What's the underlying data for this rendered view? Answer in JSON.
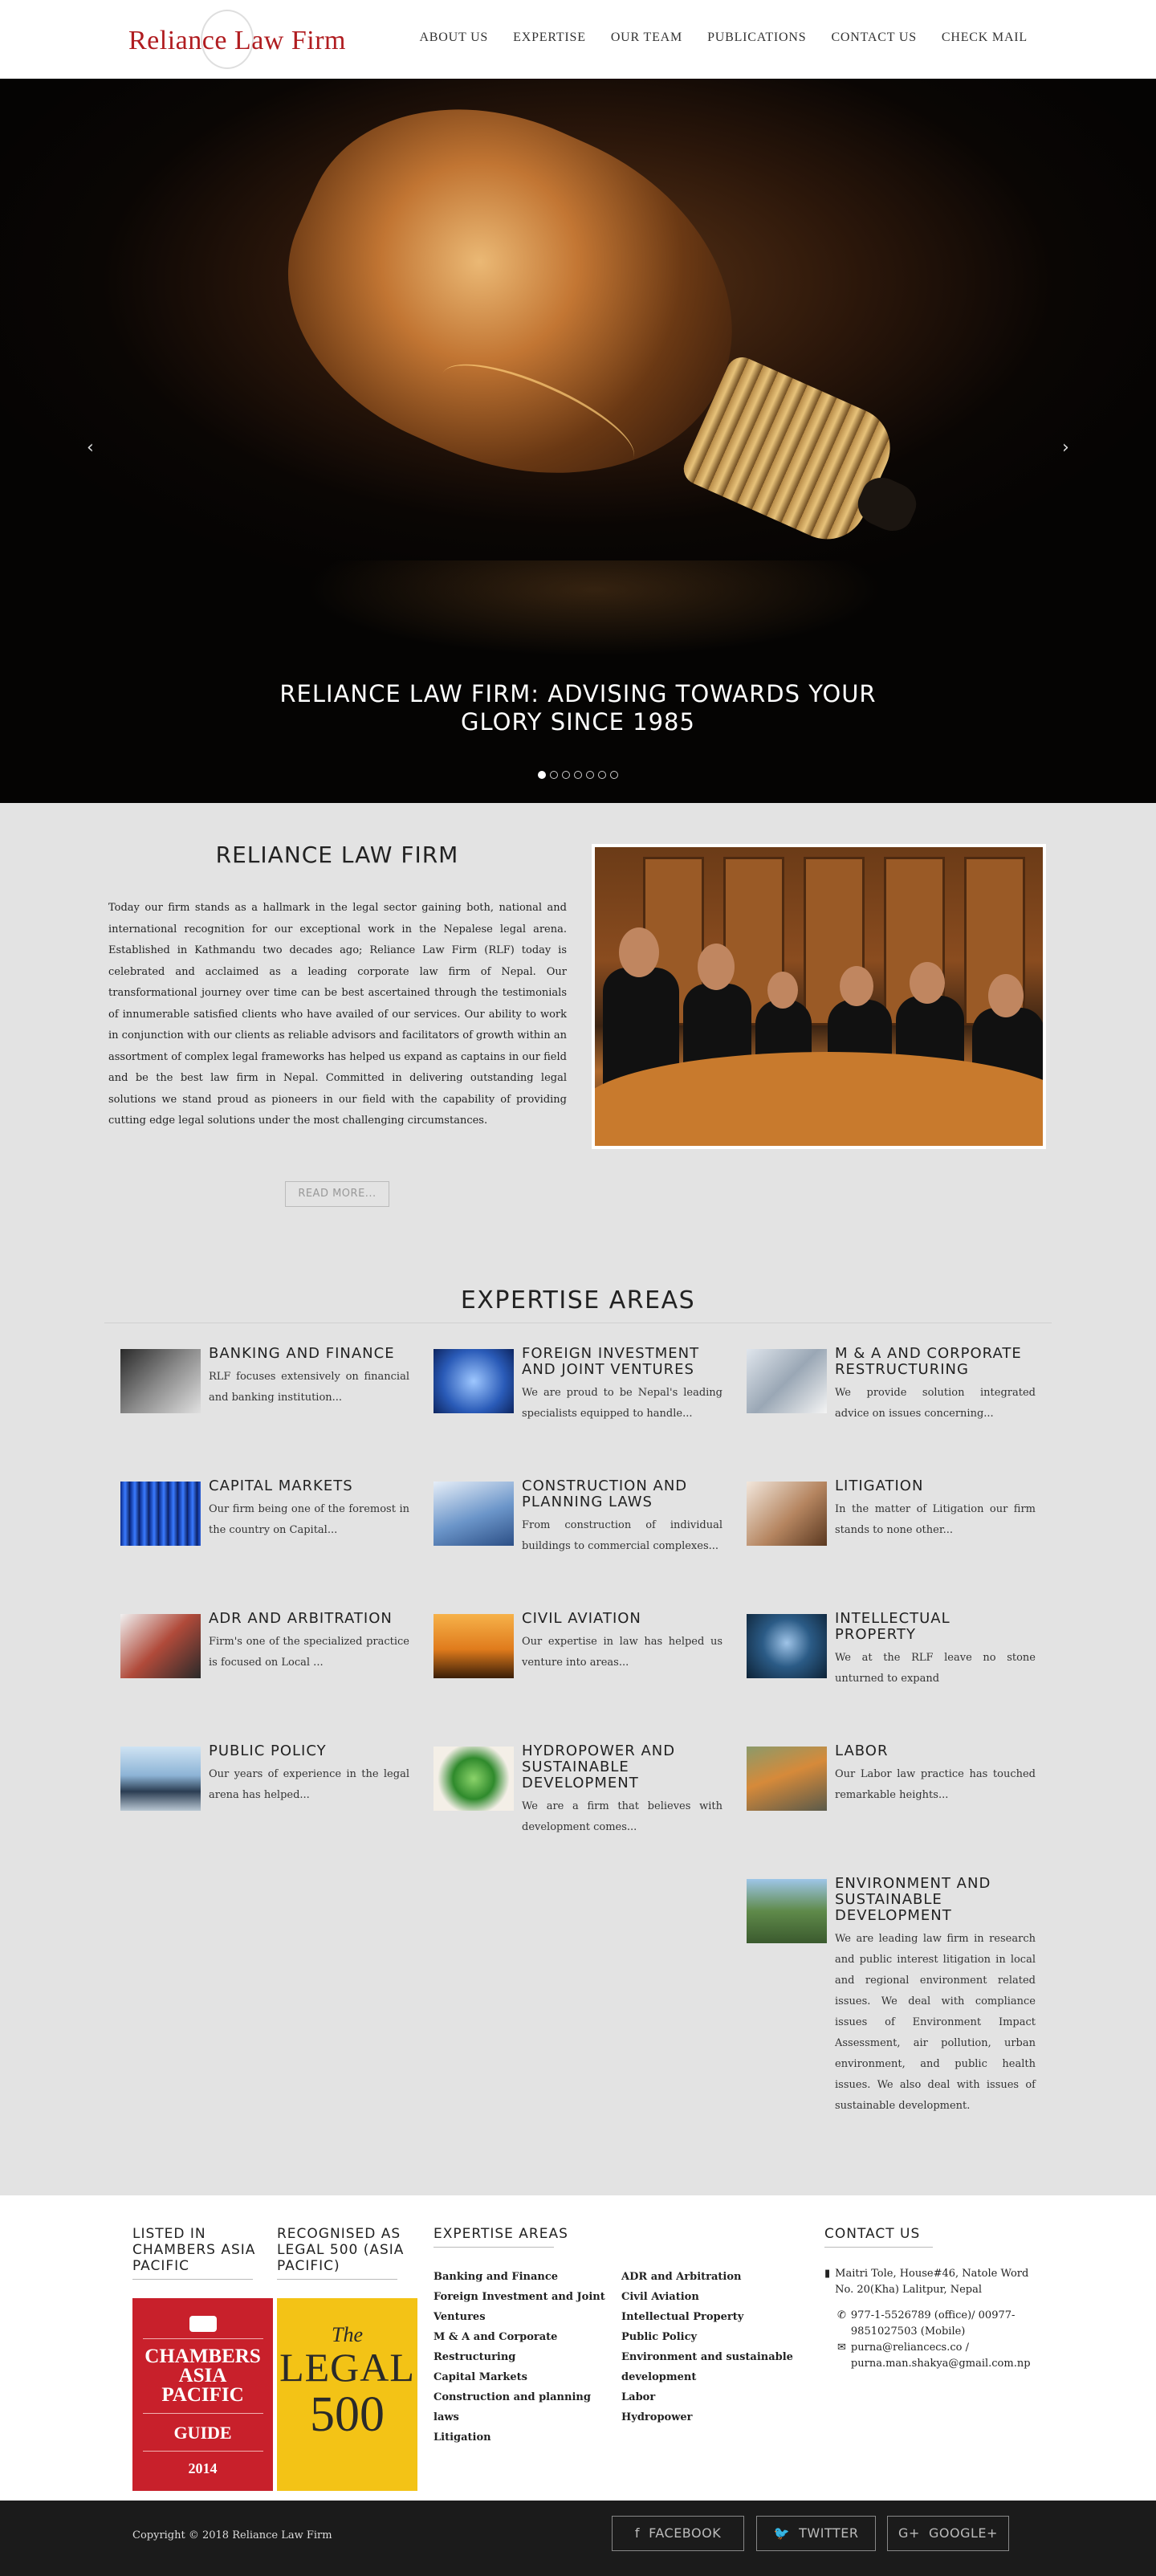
{
  "header": {
    "logo_text": "Reliance Law Firm",
    "nav": [
      "ABOUT US",
      "EXPERTISE",
      "OUR TEAM",
      "PUBLICATIONS",
      "CONTACT US",
      "CHECK MAIL"
    ]
  },
  "hero": {
    "caption": "RELIANCE LAW FIRM: ADVISING TOWARDS YOUR GLORY SINCE 1985",
    "prev_icon": "‹",
    "next_icon": "›",
    "slide_count": 7,
    "active_slide": 1
  },
  "about": {
    "title": "RELIANCE LAW FIRM",
    "text": "Today our firm stands as a hallmark in the legal sector gaining both, national and international recognition for our exceptional work in the Nepalese legal arena. Established in Kathmandu two decades ago; Reliance Law Firm (RLF) today is celebrated and acclaimed as a leading corporate law firm of Nepal. Our transformational journey over time can be best ascertained through the testimonials of innumerable satisfied clients who have availed of our services. Our ability to work in conjunction with our clients as reliable advisors and facilitators of growth within an assortment of complex legal frameworks has helped us expand as captains in our field and be the best law firm in Nepal. Committed in delivering outstanding legal solutions we stand proud as pioneers in our field with the capability of providing cutting edge legal solutions under the most challenging circumstances.",
    "read_more": "READ MORE..."
  },
  "expertise": {
    "title": "EXPERTISE AREAS",
    "items": [
      {
        "title": "BANKING AND FINANCE",
        "desc": "RLF focuses extensively on financial and banking institution..."
      },
      {
        "title": "FOREIGN INVESTMENT AND JOINT VENTURES",
        "desc": "We are proud to be Nepal's leading specialists equipped to handle..."
      },
      {
        "title": "M & A AND CORPORATE RESTRUCTURING",
        "desc": "We provide solution integrated advice on issues concerning..."
      },
      {
        "title": "CAPITAL MARKETS",
        "desc": "Our firm being one of the foremost in the country on Capital..."
      },
      {
        "title": "CONSTRUCTION AND PLANNING LAWS",
        "desc": "From construction of individual buildings to commercial complexes..."
      },
      {
        "title": "LITIGATION",
        "desc": "In the matter of Litigation our firm stands to none other..."
      },
      {
        "title": "ADR AND ARBITRATION",
        "desc": "Firm's one of the specialized practice is focused on Local ..."
      },
      {
        "title": "CIVIL AVIATION",
        "desc": "Our expertise in law has helped us venture into areas..."
      },
      {
        "title": "INTELLECTUAL PROPERTY",
        "desc": "We at the RLF leave no stone unturned to expand"
      },
      {
        "title": "PUBLIC POLICY",
        "desc": "Our years of experience in the legal arena has helped..."
      },
      {
        "title": "HYDROPOWER AND SUSTAINABLE DEVELOPMENT",
        "desc": "We are a firm that believes with development comes..."
      },
      {
        "title": "LABOR",
        "desc": "Our Labor law practice has touched remarkable heights..."
      },
      {
        "title": "ENVIRONMENT AND SUSTAINABLE DEVELOPMENT",
        "desc": "We are leading law firm in research and public interest litigation in local and regional environment related issues. We deal with compliance issues of Environment Impact Assessment, air pollution, urban environment, and public health issues. We also deal with issues of sustainable development."
      }
    ]
  },
  "footer": {
    "chambers_heading": "LISTED IN CHAMBERS ASIA PACIFIC",
    "legal500_heading": "RECOGNISED AS LEGAL 500 (ASIA PACIFIC)",
    "chambers_badge": {
      "line1": "CHAMBERS",
      "line2": "ASIA",
      "line3": "PACIFIC",
      "line4": "GUIDE",
      "year": "2014"
    },
    "legal500_badge": {
      "the": "The",
      "line1": "LEGAL",
      "line2": "500"
    },
    "expertise_heading": "EXPERTISE AREAS",
    "expertise_col1": [
      "Banking and Finance",
      "Foreign Investment and Joint Ventures",
      "M & A and Corporate Restructuring",
      "Capital Markets",
      "Construction and planning laws",
      "Litigation"
    ],
    "expertise_col2": [
      "ADR and Arbitration",
      "Civil Aviation",
      "Intellectual Property",
      "Public Policy",
      "Environment and sustainable development",
      "Labor",
      "Hydropower"
    ],
    "contact_heading": "CONTACT US",
    "address": "Maitri Tole, House#46, Natole Word No. 20(Kha) Lalitpur, Nepal",
    "phone": "977-1-5526789 (office)/ 00977-9851027503 (Mobile)",
    "email": "purna@reliancecs.co / purna.man.shakya@gmail.com.np",
    "copyright": "Copyright © 2018 Reliance Law Firm",
    "social": [
      {
        "icon": "f",
        "label": "FACEBOOK"
      },
      {
        "icon": "🐦",
        "label": "TWITTER"
      },
      {
        "icon": "G+",
        "label": "GOOGLE+"
      }
    ]
  }
}
